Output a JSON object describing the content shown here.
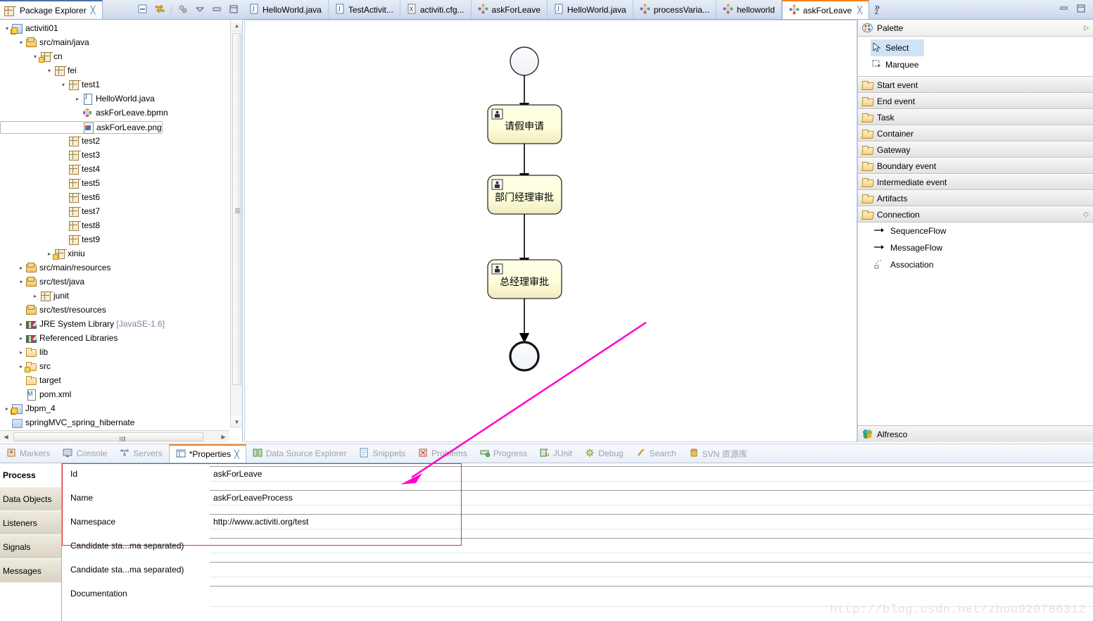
{
  "explorer": {
    "tab_label": "Package Explorer",
    "close_icon": "╳",
    "toolbar_icons": [
      "collapse-all-icon",
      "link-with-editor-icon",
      "view-menu-icon",
      "minimize-icon",
      "maximize-icon"
    ],
    "tree": [
      {
        "label": "activiti01",
        "depth": 0,
        "arrow": "open",
        "icon": "ico-proj",
        "warn": true
      },
      {
        "label": "src/main/java",
        "depth": 1,
        "arrow": "open",
        "icon": "ico-pkgroot",
        "warn": false
      },
      {
        "label": "cn",
        "depth": 2,
        "arrow": "open",
        "icon": "ico-pkg",
        "warn": true
      },
      {
        "label": "fei",
        "depth": 3,
        "arrow": "open",
        "icon": "ico-pkg",
        "warn": false
      },
      {
        "label": "test1",
        "depth": 4,
        "arrow": "open",
        "icon": "ico-pkg",
        "warn": false
      },
      {
        "label": "HelloWorld.java",
        "depth": 5,
        "arrow": "closed",
        "icon": "ico-java",
        "warn": false
      },
      {
        "label": "askForLeave.bpmn",
        "depth": 5,
        "arrow": "",
        "icon": "ico-bpmn",
        "warn": false
      },
      {
        "label": "askForLeave.png",
        "depth": 5,
        "arrow": "",
        "icon": "ico-png",
        "warn": false,
        "selected": true
      },
      {
        "label": "test2",
        "depth": 4,
        "arrow": "",
        "icon": "ico-pkg",
        "warn": false
      },
      {
        "label": "test3",
        "depth": 4,
        "arrow": "",
        "icon": "ico-pkg",
        "warn": false
      },
      {
        "label": "test4",
        "depth": 4,
        "arrow": "",
        "icon": "ico-pkg",
        "warn": false
      },
      {
        "label": "test5",
        "depth": 4,
        "arrow": "",
        "icon": "ico-pkg",
        "warn": false
      },
      {
        "label": "test6",
        "depth": 4,
        "arrow": "",
        "icon": "ico-pkg",
        "warn": false
      },
      {
        "label": "test7",
        "depth": 4,
        "arrow": "",
        "icon": "ico-pkg",
        "warn": false
      },
      {
        "label": "test8",
        "depth": 4,
        "arrow": "",
        "icon": "ico-pkg",
        "warn": false
      },
      {
        "label": "test9",
        "depth": 4,
        "arrow": "",
        "icon": "ico-pkg",
        "warn": false
      },
      {
        "label": "xiniu",
        "depth": 3,
        "arrow": "closed",
        "icon": "ico-pkg",
        "warn": true
      },
      {
        "label": "src/main/resources",
        "depth": 1,
        "arrow": "closed",
        "icon": "ico-pkgroot",
        "warn": false
      },
      {
        "label": "src/test/java",
        "depth": 1,
        "arrow": "open",
        "icon": "ico-pkgroot",
        "warn": false
      },
      {
        "label": "junit",
        "depth": 2,
        "arrow": "closed",
        "icon": "ico-pkg",
        "warn": false
      },
      {
        "label": "src/test/resources",
        "depth": 1,
        "arrow": "",
        "icon": "ico-pkgroot",
        "warn": false
      },
      {
        "label": "JRE System Library",
        "dim": " [JavaSE-1.6]",
        "depth": 1,
        "arrow": "closed",
        "icon": "ico-lib",
        "warn": false
      },
      {
        "label": "Referenced Libraries",
        "depth": 1,
        "arrow": "closed",
        "icon": "ico-lib",
        "warn": false
      },
      {
        "label": "lib",
        "depth": 1,
        "arrow": "closed",
        "icon": "ico-fold",
        "warn": false
      },
      {
        "label": "src",
        "depth": 1,
        "arrow": "closed",
        "icon": "ico-fold",
        "warn": true
      },
      {
        "label": "target",
        "depth": 1,
        "arrow": "",
        "icon": "ico-fold",
        "warn": false
      },
      {
        "label": "pom.xml",
        "depth": 1,
        "arrow": "",
        "icon": "ico-xml",
        "warn": false
      },
      {
        "label": "Jbpm_4",
        "depth": 0,
        "arrow": "closed",
        "icon": "ico-prj2",
        "warn": true
      },
      {
        "label": "springMVC_spring_hibernate",
        "depth": 0,
        "arrow": "",
        "icon": "ico-plain",
        "warn": false
      }
    ]
  },
  "editor_tabs": {
    "tabs": [
      {
        "label": "HelloWorld.java",
        "icon": "java-file-icon",
        "active": false
      },
      {
        "label": "TestActivit...",
        "icon": "java-file-icon",
        "active": false
      },
      {
        "label": "activiti.cfg...",
        "icon": "xml-file-icon",
        "active": false
      },
      {
        "label": "askForLeave",
        "icon": "bpmn-file-icon",
        "active": false
      },
      {
        "label": "HelloWorld.java",
        "icon": "java-file-icon",
        "active": false
      },
      {
        "label": "processVaria...",
        "icon": "bpmn-file-icon",
        "active": false
      },
      {
        "label": "helloworld",
        "icon": "bpmn-file-icon",
        "active": false
      },
      {
        "label": "askForLeave",
        "icon": "bpmn-file-icon",
        "active": true,
        "close_icon": "╳"
      }
    ],
    "more_label": "»",
    "more_count": "2",
    "minimize_icon": "minimize-icon",
    "maximize_icon": "maximize-icon"
  },
  "diagram": {
    "start_event": {
      "type": "start-event"
    },
    "nodes": [
      {
        "label": "请假申请",
        "type": "user-task"
      },
      {
        "label": "部门经理审批",
        "type": "user-task"
      },
      {
        "label": "总经理审批",
        "type": "user-task"
      }
    ],
    "end_event": {
      "type": "end-event"
    },
    "task_fill_top": "#ffffe0",
    "task_fill_bottom": "#f3eec3"
  },
  "palette": {
    "title": "Palette",
    "expand_icon": "▷",
    "tools": [
      {
        "label": "Select",
        "icon": "cursor-icon",
        "selected": true
      },
      {
        "label": "Marquee",
        "icon": "marquee-icon",
        "selected": false
      }
    ],
    "drawers": [
      {
        "label": "Start event"
      },
      {
        "label": "End event"
      },
      {
        "label": "Task"
      },
      {
        "label": "Container"
      },
      {
        "label": "Gateway"
      },
      {
        "label": "Boundary event"
      },
      {
        "label": "Intermediate event"
      },
      {
        "label": "Artifacts"
      },
      {
        "label": "Connection",
        "expanded": true,
        "collapse_icon": "◇"
      }
    ],
    "connections": [
      {
        "label": "SequenceFlow",
        "icon": "arrow-right-icon"
      },
      {
        "label": "MessageFlow",
        "icon": "arrow-right-icon"
      },
      {
        "label": "Association",
        "icon": "association-icon"
      }
    ],
    "footer": {
      "label": "Alfresco",
      "icon": "alfresco-icon"
    }
  },
  "bottom_views": {
    "tabs": [
      {
        "label": "Markers",
        "icon": "markers-icon",
        "active": false
      },
      {
        "label": "Console",
        "icon": "console-icon",
        "active": false
      },
      {
        "label": "Servers",
        "icon": "servers-icon",
        "active": false
      },
      {
        "label": "*Properties",
        "icon": "properties-icon",
        "active": true,
        "close_icon": "╳"
      },
      {
        "label": "Data Source Explorer",
        "icon": "datasource-icon",
        "active": false
      },
      {
        "label": "Snippets",
        "icon": "snippets-icon",
        "active": false
      },
      {
        "label": "Problems",
        "icon": "problems-icon",
        "active": false
      },
      {
        "label": "Progress",
        "icon": "progress-icon",
        "active": false
      },
      {
        "label": "JUnit",
        "icon": "junit-icon",
        "active": false
      },
      {
        "label": "Debug",
        "icon": "debug-icon",
        "active": false
      },
      {
        "label": "Search",
        "icon": "search-icon",
        "active": false
      },
      {
        "label": "SVN 资源库",
        "icon": "svn-icon",
        "active": false
      }
    ]
  },
  "properties": {
    "side_tabs": [
      {
        "label": "Process",
        "active": true
      },
      {
        "label": "Data Objects",
        "active": false
      },
      {
        "label": "Listeners",
        "active": false
      },
      {
        "label": "Signals",
        "active": false
      },
      {
        "label": "Messages",
        "active": false
      }
    ],
    "fields": [
      {
        "label": "Id",
        "value": "askForLeave"
      },
      {
        "label": "Name",
        "value": "askForLeaveProcess"
      },
      {
        "label": "Namespace",
        "value": "http://www.activiti.org/test"
      },
      {
        "label": "Candidate sta...ma separated)",
        "value": ""
      },
      {
        "label": "Candidate sta...ma separated)",
        "value": ""
      },
      {
        "label": "Documentation",
        "value": ""
      }
    ],
    "highlight_color": "#e03434"
  },
  "annotation": {
    "arrow_color": "#ff00d0"
  },
  "watermark": {
    "text": "http://blog.csdn.net/zhou920786312"
  }
}
